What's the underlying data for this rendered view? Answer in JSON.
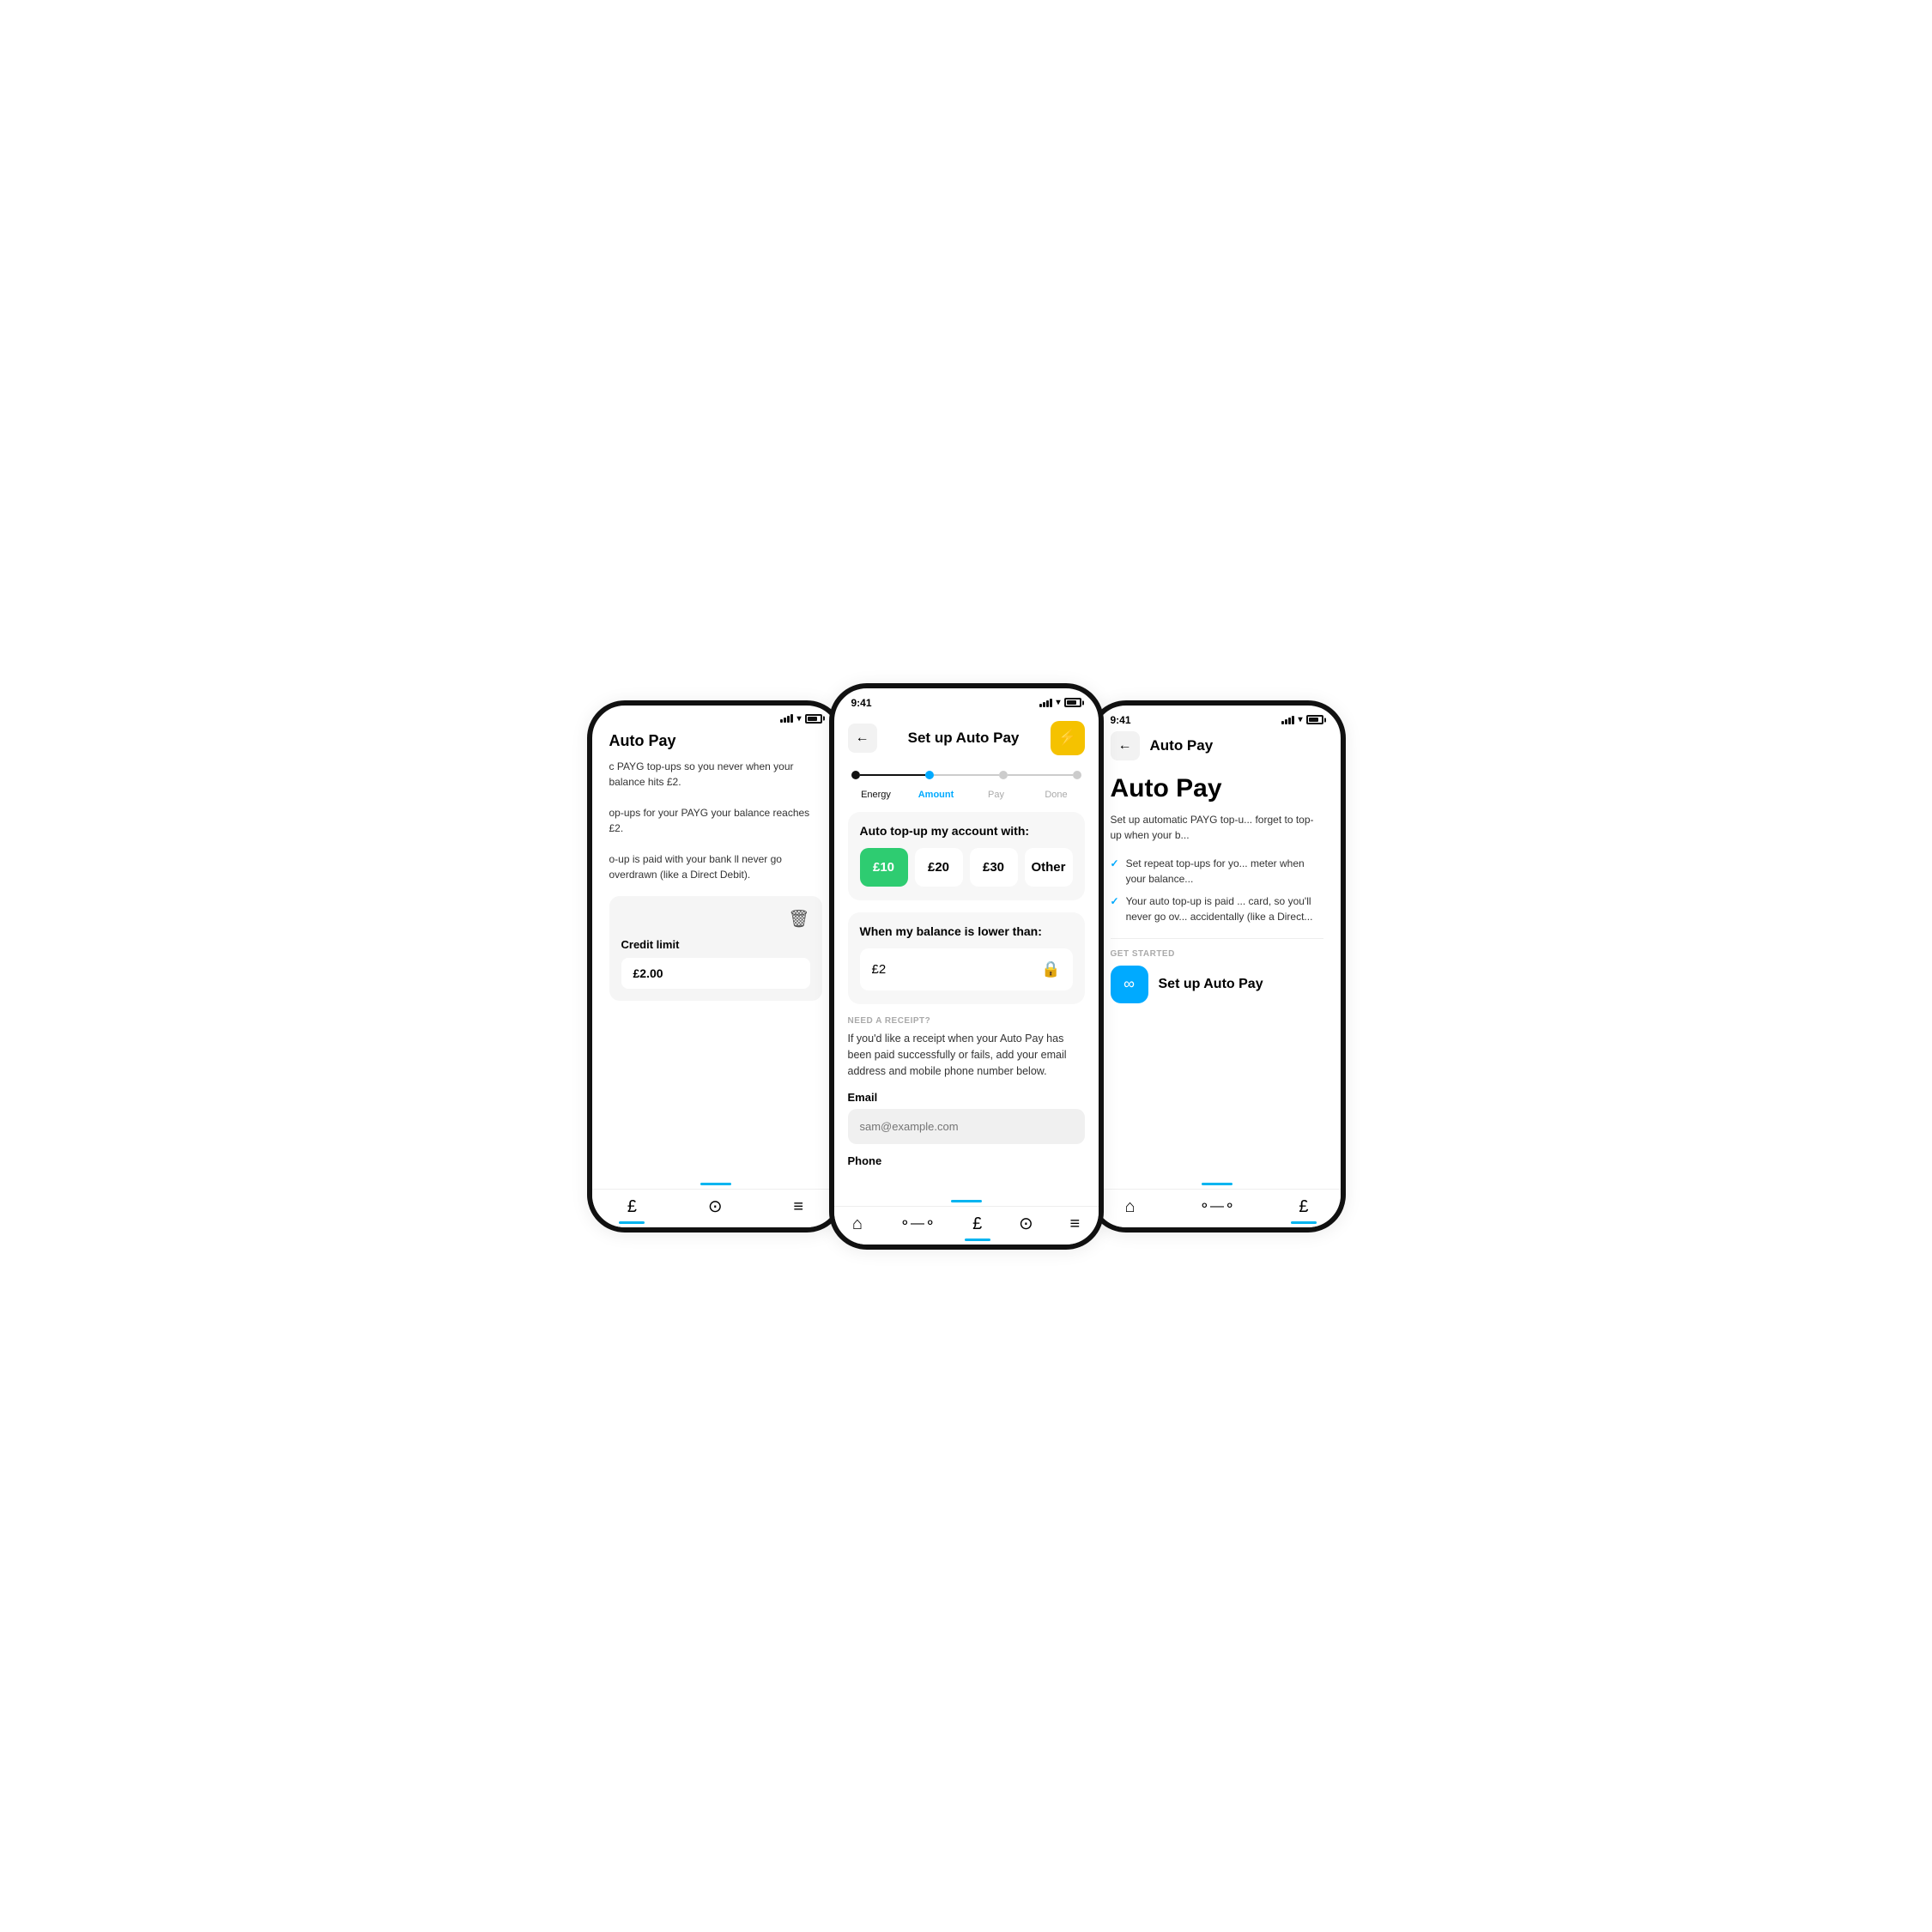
{
  "left_phone": {
    "title": "Auto Pay",
    "description_1": "c PAYG top-ups so you never when your balance hits £2.",
    "description_2": "op-ups for your PAYG your balance reaches £2.",
    "description_3": "o-up is paid with your bank ll never go overdrawn (like a Direct Debit).",
    "credit_label": "Credit limit",
    "credit_value": "£2.00",
    "bottom_tabs": [
      "£",
      "?",
      "≡"
    ],
    "active_tab": 0
  },
  "center_phone": {
    "time": "9:41",
    "header_title": "Set up Auto Pay",
    "back_icon": "←",
    "lightning_icon": "⚡",
    "steps": [
      {
        "label": "Energy",
        "state": "done"
      },
      {
        "label": "Amount",
        "state": "active"
      },
      {
        "label": "Pay",
        "state": "upcoming"
      },
      {
        "label": "Done",
        "state": "upcoming"
      }
    ],
    "card_1_title": "Auto top-up my account with:",
    "amounts": [
      {
        "value": "£10",
        "selected": true
      },
      {
        "value": "£20",
        "selected": false
      },
      {
        "value": "£30",
        "selected": false
      },
      {
        "value": "Other",
        "selected": false
      }
    ],
    "card_2_title": "When my balance is lower than:",
    "balance_trigger": "£2",
    "receipt_label": "NEED A RECEIPT?",
    "receipt_desc": "If you'd like a receipt when your Auto Pay has been paid successfully or fails, add your email address and mobile phone number below.",
    "email_label": "Email",
    "email_placeholder": "sam@example.com",
    "phone_label": "Phone",
    "bottom_tabs": [
      "🏠",
      "⚭",
      "£",
      "?",
      "≡"
    ],
    "active_tab": 2
  },
  "right_phone": {
    "time": "9:41",
    "back_icon": "←",
    "header_title": "Auto Pay",
    "main_title": "Auto Pay",
    "description": "Set up automatic PAYG top-u... forget to top-up when your b...",
    "bullets": [
      "Set repeat top-ups for yo... meter when your balance...",
      "Your auto top-up is paid ... card, so you'll never go ov... accidentally (like a Direct..."
    ],
    "get_started_label": "GET STARTED",
    "setup_btn_label": "Set up Auto Pay",
    "setup_btn_icon": "∞",
    "bottom_tabs": [
      "🏠",
      "⚭",
      "£"
    ],
    "active_tab": 2
  },
  "colors": {
    "accent_blue": "#00aaff",
    "accent_green": "#2ecc71",
    "accent_yellow": "#f5c200",
    "active_tab": "#00b4f0"
  }
}
